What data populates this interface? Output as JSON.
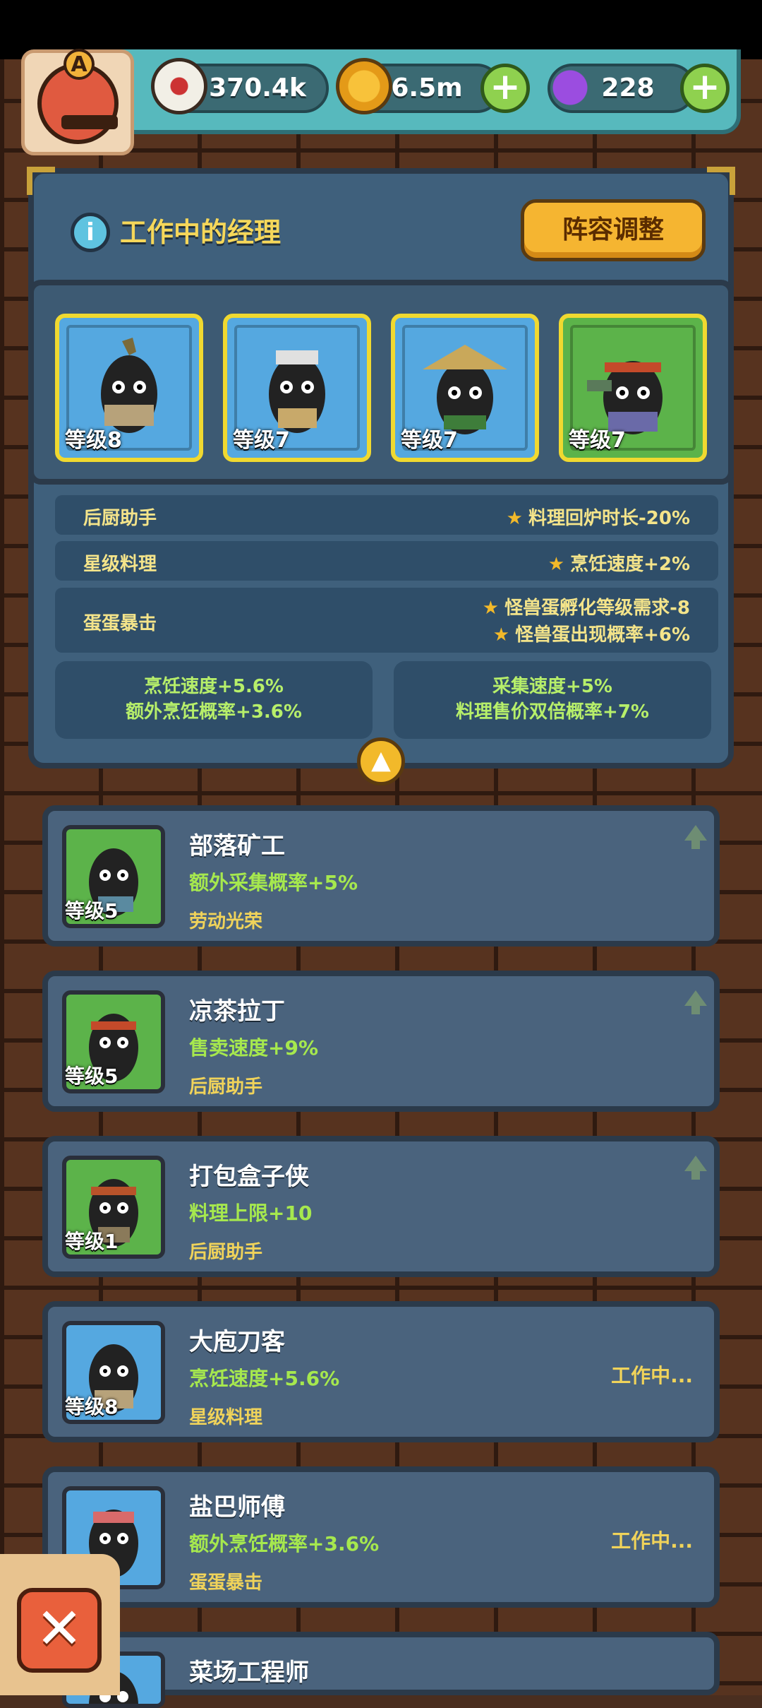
{
  "resources": {
    "eyeball": {
      "value": "370.4k",
      "icon": "eyeball-icon"
    },
    "coin": {
      "value": "6.5m",
      "icon": "coin-icon"
    },
    "potion": {
      "value": "228",
      "icon": "potion-icon"
    }
  },
  "rank_badge": {
    "letter": "A"
  },
  "panel": {
    "title": "工作中的经理",
    "lineup_button": "阵容调整",
    "slots": [
      {
        "level": "等级8",
        "bg": "blue"
      },
      {
        "level": "等级7",
        "bg": "blue"
      },
      {
        "level": "等级7",
        "bg": "blue"
      },
      {
        "level": "等级7",
        "bg": "green"
      }
    ],
    "bonuses": [
      {
        "name": "后厨助手",
        "effects": [
          "料理回炉时长-20%"
        ]
      },
      {
        "name": "星级料理",
        "effects": [
          "烹饪速度+2%"
        ]
      },
      {
        "name": "蛋蛋暴击",
        "effects": [
          "怪兽蛋孵化等级需求-8",
          "怪兽蛋出现概率+6%"
        ]
      }
    ],
    "summary_left": [
      "烹饪速度+5.6%",
      "额外烹饪概率+3.6%"
    ],
    "summary_right": [
      "采集速度+5%",
      "料理售价双倍概率+7%"
    ]
  },
  "cards": [
    {
      "name": "部落矿工",
      "effect": "额外采集概率+5%",
      "skill": "劳动光荣",
      "level": "等级5",
      "bg": "green",
      "status": ""
    },
    {
      "name": "凉茶拉丁",
      "effect": "售卖速度+9%",
      "skill": "后厨助手",
      "level": "等级5",
      "bg": "green",
      "status": ""
    },
    {
      "name": "打包盒子侠",
      "effect": "料理上限+10",
      "skill": "后厨助手",
      "level": "等级1",
      "bg": "green",
      "status": ""
    },
    {
      "name": "大庖刀客",
      "effect": "烹饪速度+5.6%",
      "skill": "星级料理",
      "level": "等级8",
      "bg": "blue",
      "status": "工作中..."
    },
    {
      "name": "盐巴师傅",
      "effect": "额外烹饪概率+3.6%",
      "skill": "蛋蛋暴击",
      "level": "",
      "bg": "blue",
      "status": "工作中..."
    },
    {
      "name": "菜场工程师",
      "effect": "",
      "skill": "",
      "level": "",
      "bg": "blue",
      "status": ""
    }
  ]
}
